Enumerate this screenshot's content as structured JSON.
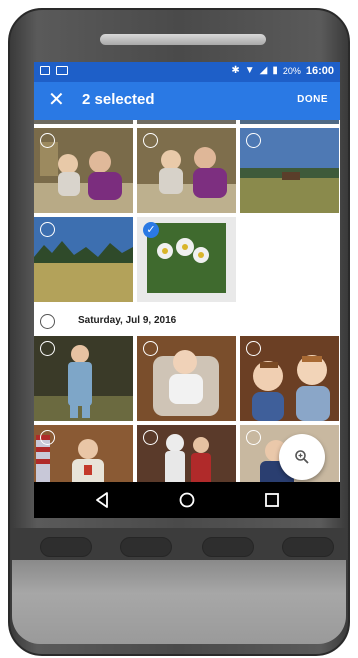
{
  "status_bar": {
    "icons": [
      "image-icon",
      "gallery-icon",
      "bluetooth-icon",
      "wifi-icon",
      "signal-icon",
      "battery-icon"
    ],
    "battery": "20%",
    "time": "16:00"
  },
  "app_bar": {
    "title": "2 selected",
    "done_label": "DONE"
  },
  "groups": [
    {
      "photos": [
        {
          "subject": "grandparents-with-child",
          "selected": false
        },
        {
          "subject": "grandparents-with-child",
          "selected": false
        },
        {
          "subject": "ranch-landscape",
          "selected": false
        },
        {
          "subject": "meadow-trees",
          "selected": false
        },
        {
          "subject": "wildflowers",
          "selected": true
        }
      ]
    },
    {
      "date": "Saturday, Jul 9, 2016",
      "photos": [
        {
          "subject": "boy-in-suit",
          "selected": false
        },
        {
          "subject": "baby-in-bouncer",
          "selected": false
        },
        {
          "subject": "two-toddlers",
          "selected": false
        },
        {
          "subject": "scout-with-flag",
          "selected": false
        },
        {
          "subject": "kids-in-costume",
          "selected": false
        },
        {
          "subject": "child-in-blue",
          "selected": false
        }
      ]
    }
  ],
  "colors": {
    "app_bar": "#2a79e4",
    "status_bar": "#1e5fc8",
    "check_accent": "#2a79e4"
  }
}
